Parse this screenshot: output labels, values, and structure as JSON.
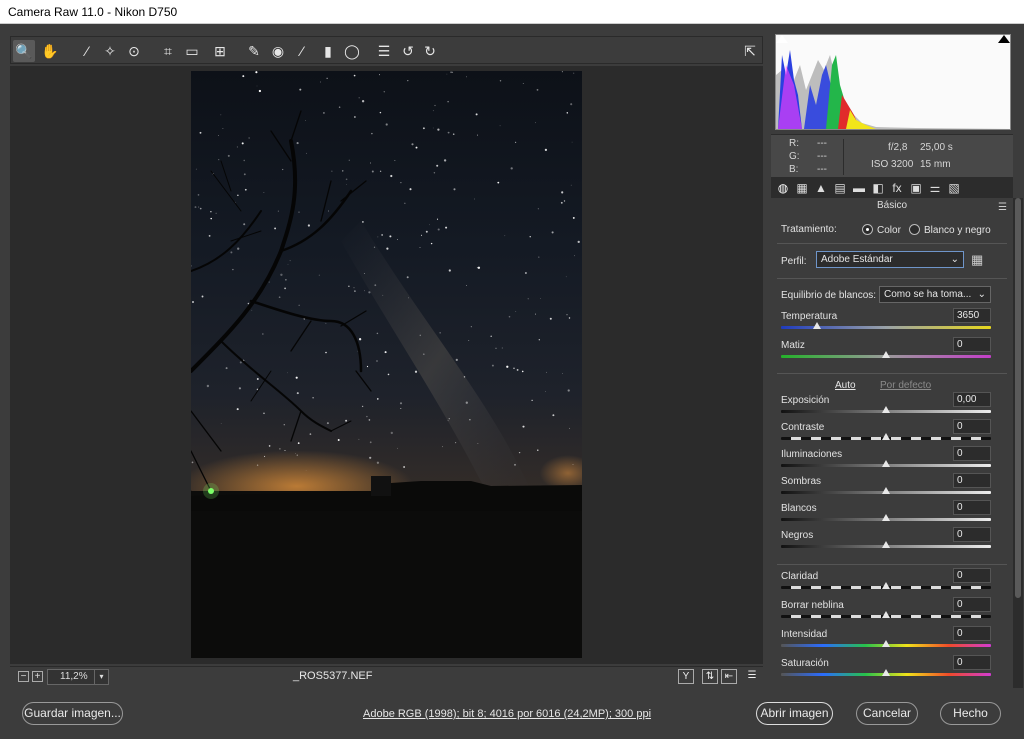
{
  "window": {
    "title": "Camera Raw 11.0 -  Nikon D750"
  },
  "toolbar": {
    "tools": [
      {
        "name": "zoom-tool",
        "glyph": "🔍"
      },
      {
        "name": "hand-tool",
        "glyph": "✋"
      },
      {
        "name": "white-balance-tool",
        "glyph": "⁄"
      },
      {
        "name": "color-sampler-tool",
        "glyph": "✧"
      },
      {
        "name": "targeted-adjustment-tool",
        "glyph": "⊙"
      },
      {
        "name": "crop-tool",
        "glyph": "⌗"
      },
      {
        "name": "straighten-tool",
        "glyph": "▭"
      },
      {
        "name": "transform-tool",
        "glyph": "⊞"
      },
      {
        "name": "spot-removal-tool",
        "glyph": "✎"
      },
      {
        "name": "red-eye-tool",
        "glyph": "◉"
      },
      {
        "name": "adjustment-brush-tool",
        "glyph": "⁄"
      },
      {
        "name": "graduated-filter-tool",
        "glyph": "▮"
      },
      {
        "name": "radial-filter-tool",
        "glyph": "◯"
      },
      {
        "name": "preferences-tool",
        "glyph": "☰"
      },
      {
        "name": "rotate-left-tool",
        "glyph": "↺"
      },
      {
        "name": "rotate-right-tool",
        "glyph": "↻"
      }
    ],
    "fullscreen_glyph": "⇱"
  },
  "status": {
    "zoom_value": "11,2%",
    "zoom_minus": "−",
    "zoom_plus": "+",
    "filename": "_ROS5377.NEF",
    "view_buttons": [
      "Y",
      "⇅",
      "⇤",
      "☰"
    ]
  },
  "info": {
    "r_label": "R:",
    "g_label": "G:",
    "b_label": "B:",
    "r_value": "---",
    "g_value": "---",
    "b_value": "---",
    "aperture": "f/2,8",
    "shutter": "25,00 s",
    "iso": "ISO 3200",
    "focal": "15 mm"
  },
  "panel": {
    "title": "Básico",
    "tabs": [
      "◍",
      "▦",
      "▲",
      "▤",
      "▬",
      "◧",
      "fx",
      "▣",
      "⚌",
      "▧"
    ],
    "treatment_label": "Tratamiento:",
    "treatment_color": "Color",
    "treatment_bw": "Blanco y negro",
    "profile_label": "Perfil:",
    "profile_value": "Adobe Estándar",
    "wb_label": "Equilibrio de blancos:",
    "wb_value": "Como se ha toma...",
    "auto_label": "Auto",
    "default_label": "Por defecto",
    "sliders": [
      {
        "label": "Temperatura",
        "value": "3650",
        "position": 0.17,
        "gradient": "temp"
      },
      {
        "label": "Matiz",
        "value": "0",
        "position": 0.5,
        "gradient": "tint"
      },
      {
        "label": "Exposición",
        "value": "0,00",
        "position": 0.5,
        "gradient": "gray"
      },
      {
        "label": "Contraste",
        "value": "0",
        "position": 0.5,
        "gradient": "dashed"
      },
      {
        "label": "Iluminaciones",
        "value": "0",
        "position": 0.5,
        "gradient": "gray"
      },
      {
        "label": "Sombras",
        "value": "0",
        "position": 0.5,
        "gradient": "gray"
      },
      {
        "label": "Blancos",
        "value": "0",
        "position": 0.5,
        "gradient": "gray"
      },
      {
        "label": "Negros",
        "value": "0",
        "position": 0.5,
        "gradient": "gray"
      },
      {
        "label": "Claridad",
        "value": "0",
        "position": 0.5,
        "gradient": "dashed"
      },
      {
        "label": "Borrar neblina",
        "value": "0",
        "position": 0.5,
        "gradient": "dashed"
      },
      {
        "label": "Intensidad",
        "value": "0",
        "position": 0.5,
        "gradient": "rainbow"
      },
      {
        "label": "Saturación",
        "value": "0",
        "position": 0.5,
        "gradient": "rainbow"
      }
    ]
  },
  "bottom": {
    "save_label": "Guardar imagen...",
    "workflow_label": "Adobe RGB (1998); bit 8; 4016 por 6016 (24,2MP); 300 ppi",
    "open_label": "Abrir imagen",
    "cancel_label": "Cancelar",
    "done_label": "Hecho"
  },
  "colors": {
    "accent": "#6f95c9",
    "panel_bg": "#3c3c3c",
    "dark_bg": "#2b2b2b"
  }
}
